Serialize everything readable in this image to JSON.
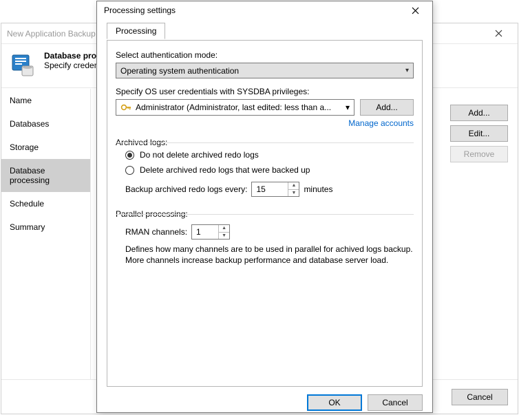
{
  "parent": {
    "title": "New Application Backup",
    "heading": "Database processing",
    "subheading": "Specify credentials",
    "nav": [
      "Name",
      "Databases",
      "Storage",
      "Database processing",
      "Schedule",
      "Summary"
    ],
    "nav_selected_index": 3,
    "buttons": {
      "add": "Add...",
      "edit": "Edit...",
      "remove": "Remove"
    },
    "footer_cancel": "Cancel"
  },
  "dialog": {
    "title": "Processing settings",
    "tab_label": "Processing",
    "auth": {
      "label": "Select authentication mode:",
      "value": "Operating system authentication"
    },
    "cred": {
      "label": "Specify OS user credentials with SYSDBA privileges:",
      "value": "Administrator (Administrator, last edited: less than a...",
      "add_button": "Add...",
      "manage_link": "Manage accounts"
    },
    "archived_logs": {
      "header": "Archived logs:",
      "opt_keep": "Do not delete archived redo logs",
      "opt_delete": "Delete archived redo logs that were backed up",
      "selected": "keep",
      "interval_label_pre": "Backup archived redo logs every:",
      "interval_value": "15",
      "interval_unit": "minutes"
    },
    "parallel": {
      "header": "Parallel processing:",
      "channels_label": "RMAN channels:",
      "channels_value": "1",
      "hint": "Defines how many channels are to be used in parallel for achived logs backup. More channels increase backup performance and database server load."
    },
    "footer": {
      "ok": "OK",
      "cancel": "Cancel"
    }
  }
}
